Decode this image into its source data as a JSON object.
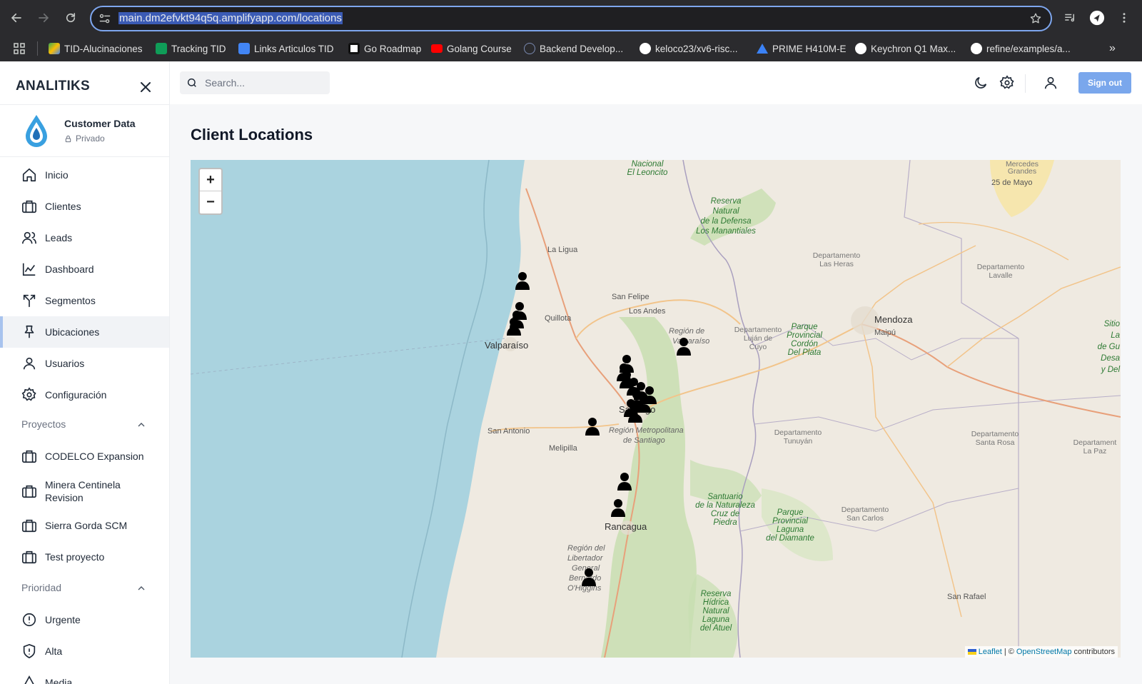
{
  "browser": {
    "url_host": "main.dm2efvkt94q5q.amplifyapp.com",
    "url_path": "/locations",
    "bookmarks": [
      {
        "label": "TID-Alucinaciones",
        "color": "#4285f4"
      },
      {
        "label": "Tracking TID",
        "color": "#0f9d58"
      },
      {
        "label": "Links Articulos TID",
        "color": "#4285f4"
      },
      {
        "label": "Go Roadmap",
        "color": "#111111"
      },
      {
        "label": "Golang Course",
        "color": "#ff0000"
      },
      {
        "label": "Backend Develop...",
        "color": "#5b6b9a"
      },
      {
        "label": "keloco23/xv6-risc...",
        "color": "#ffffff"
      },
      {
        "label": "PRIME H410M-E",
        "color": "#3b82f6"
      },
      {
        "label": "Keychron Q1 Max...",
        "color": "#ffffff"
      },
      {
        "label": "refine/examples/a...",
        "color": "#ffffff"
      }
    ],
    "more_label": "»"
  },
  "sidebar": {
    "brand": "ANALITIKS",
    "workspace": {
      "name": "Customer Data",
      "visibility": "Privado"
    },
    "items": [
      {
        "label": "Inicio",
        "icon": "home-icon"
      },
      {
        "label": "Clientes",
        "icon": "briefcase-icon"
      },
      {
        "label": "Leads",
        "icon": "users-icon"
      },
      {
        "label": "Dashboard",
        "icon": "chart-icon"
      },
      {
        "label": "Segmentos",
        "icon": "split-icon"
      },
      {
        "label": "Ubicaciones",
        "icon": "pin-icon",
        "active": true
      },
      {
        "label": "Usuarios",
        "icon": "user-icon"
      },
      {
        "label": "Configuración",
        "icon": "gear-icon"
      }
    ],
    "projects_header": "Proyectos",
    "projects": [
      {
        "label": "CODELCO Expansion"
      },
      {
        "label": "Minera Centinela Revision"
      },
      {
        "label": "Sierra Gorda SCM"
      },
      {
        "label": "Test proyecto"
      }
    ],
    "priority_header": "Prioridad",
    "priorities": [
      {
        "label": "Urgente",
        "icon": "alert-circle-icon"
      },
      {
        "label": "Alta",
        "icon": "shield-alert-icon"
      },
      {
        "label": "Media",
        "icon": "alert-triangle-icon"
      }
    ]
  },
  "topbar": {
    "search_placeholder": "Search...",
    "signout_label": "Sign out"
  },
  "page": {
    "title": "Client Locations"
  },
  "map": {
    "zoom_in": "+",
    "zoom_out": "−",
    "attribution": {
      "leaflet": "Leaflet",
      "sep": "| ©",
      "osm": "OpenStreetMap",
      "tail": "contributors"
    },
    "labels": {
      "la_ligua": "La Ligua",
      "quillota": "Quillota",
      "valparaiso": "Valparaíso",
      "san_felipe": "San Felipe",
      "los_andes": "Los Andes",
      "region_valparaiso_1": "Región de",
      "region_valparaiso_2": "Valparaíso",
      "santiago": "Santiago",
      "region_metro_1": "Región Metropolitana",
      "region_metro_2": "de Santiago",
      "san_antonio": "San Antonio",
      "melipilla": "Melipilla",
      "rancagua": "Rancagua",
      "region_libertador_1": "Región del",
      "region_libertador_2": "Libertador",
      "region_libertador_3": "General",
      "region_libertador_4": "Bernardo",
      "region_libertador_5": "O'Higgins",
      "mendoza": "Mendoza",
      "maipu": "Maipú",
      "san_rafael": "San Rafael",
      "nacional_leoncito_1": "Nacional",
      "nacional_leoncito_2": "El Leoncito",
      "reserva_defensa_1": "Reserva",
      "reserva_defensa_2": "Natural",
      "reserva_defensa_3": "de la Defensa",
      "reserva_defensa_4": "Los Manantiales",
      "dept_las_heras_1": "Departamento",
      "dept_las_heras_2": "Las Heras",
      "dept_lavalle_1": "Departamento",
      "dept_lavalle_2": "Lavalle",
      "dept_lujan_1": "Departamento",
      "dept_lujan_2": "Luján de",
      "dept_lujan_3": "Cuyo",
      "parque_cordon_1": "Parque",
      "parque_cordon_2": "Provincial",
      "parque_cordon_3": "Cordón",
      "parque_cordon_4": "Del Plata",
      "dept_tunuyan_1": "Departamento",
      "dept_tunuyan_2": "Tunuyán",
      "dept_santa_rosa_1": "Departamento",
      "dept_santa_rosa_2": "Santa Rosa",
      "dept_la_paz_1": "Departament",
      "dept_la_paz_2": "La Paz",
      "santuario_1": "Santuario",
      "santuario_2": "de la Naturaleza",
      "santuario_3": "Cruz de",
      "santuario_4": "Piedra",
      "parque_diamante_1": "Parque",
      "parque_diamante_2": "Provincial",
      "parque_diamante_3": "Laguna",
      "parque_diamante_4": "del Diamante",
      "dept_san_carlos_1": "Departamento",
      "dept_san_carlos_2": "San Carlos",
      "reserva_atuel_1": "Reserva",
      "reserva_atuel_2": "Hídrica",
      "reserva_atuel_3": "Natural",
      "reserva_atuel_4": "Laguna",
      "reserva_atuel_5": "del Atuel",
      "mercedes_1": "Mercedes",
      "mercedes_2": "Grandes",
      "veinticinco_mayo": "25 de Mayo",
      "sitio_1": "Sitio",
      "sitio_2": "La",
      "sitio_3": "de Gu",
      "sitio_4": "Desa",
      "sitio_5": "y Del"
    }
  }
}
